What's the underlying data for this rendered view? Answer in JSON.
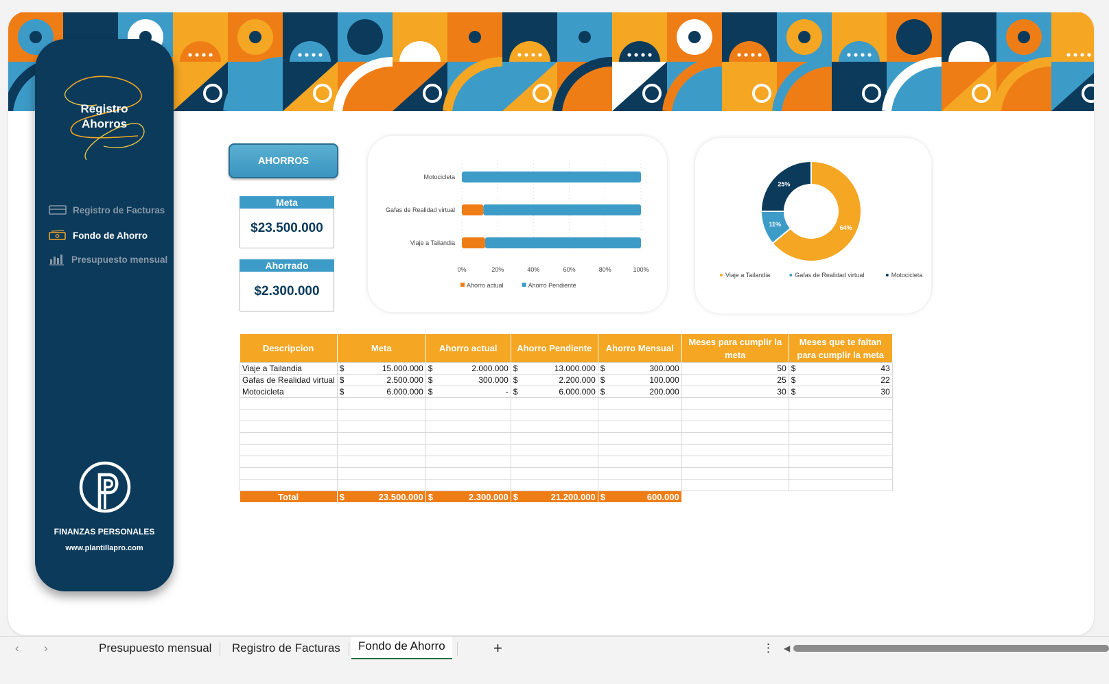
{
  "sidebar": {
    "title_line1": "Registro",
    "title_line2": "Ahorros",
    "nav": [
      {
        "label": "Registro  de Facturas"
      },
      {
        "label": "Fondo de Ahorro"
      },
      {
        "label": "Presupuesto mensual"
      }
    ],
    "brand": "FINANZAS PERSONALES",
    "website": "www.plantillapro.com"
  },
  "button_ahorros": "AHORROS",
  "kpis": {
    "meta_label": "Meta",
    "meta_value": "$23.500.000",
    "ahorrado_label": "Ahorrado",
    "ahorrado_value": "$2.300.000"
  },
  "chart_data": [
    {
      "type": "bar",
      "orientation": "horizontal",
      "stacked": "percent",
      "categories": [
        "Motocicleta",
        "Gafas de Realidad virtual",
        "Viaje a Tailandia"
      ],
      "series": [
        {
          "name": "Ahorro actual",
          "color": "#ef7d16",
          "values": [
            0,
            12,
            13
          ]
        },
        {
          "name": "Ahorro Pendiente",
          "color": "#3d9bc8",
          "values": [
            100,
            88,
            87
          ]
        }
      ],
      "x_ticks": [
        "0%",
        "20%",
        "40%",
        "60%",
        "80%",
        "100%"
      ],
      "xlim": [
        0,
        100
      ],
      "legend": "bottom"
    },
    {
      "type": "pie",
      "donut": true,
      "slices": [
        {
          "name": "Viaje a Tailandia",
          "value": 64,
          "label": "64%",
          "color": "#f5a623"
        },
        {
          "name": "Gafas de Realidad virtual",
          "value": 11,
          "label": "11%",
          "color": "#3d9bc8"
        },
        {
          "name": "Motocicleta",
          "value": 25,
          "label": "25%",
          "color": "#0b3a5b"
        }
      ],
      "legend": "bottom"
    }
  ],
  "table": {
    "headers": [
      "Descripcion",
      "Meta",
      "Ahorro actual",
      "Ahorro Pendiente",
      "Ahorro Mensual",
      "Meses para cumplir la meta",
      "Meses que te faltan para cumplir la meta"
    ],
    "rows": [
      {
        "desc": "Viaje a Tailandia",
        "meta": "15.000.000",
        "actual": "2.000.000",
        "pendiente": "13.000.000",
        "mensual": "300.000",
        "meses": "50",
        "faltan": "43"
      },
      {
        "desc": "Gafas de Realidad virtual",
        "meta": "2.500.000",
        "actual": "300.000",
        "pendiente": "2.200.000",
        "mensual": "100.000",
        "meses": "25",
        "faltan": "22"
      },
      {
        "desc": "Motocicleta",
        "meta": "6.000.000",
        "actual": "-",
        "pendiente": "6.000.000",
        "mensual": "200.000",
        "meses": "30",
        "faltan": "30"
      }
    ],
    "currency": "$",
    "total": {
      "label": "Total",
      "meta": "23.500.000",
      "actual": "2.300.000",
      "pendiente": "21.200.000",
      "mensual": "600.000"
    }
  },
  "tabs": {
    "items": [
      "Presupuesto mensual",
      "Registro de Facturas",
      "Fondo de Ahorro"
    ],
    "active": "Fondo de Ahorro",
    "add": "+",
    "more": "⋮"
  },
  "colors": {
    "navy": "#0b3a5b",
    "orange": "#ef7d16",
    "yellow": "#f5a623",
    "blue": "#3d9bc8"
  }
}
